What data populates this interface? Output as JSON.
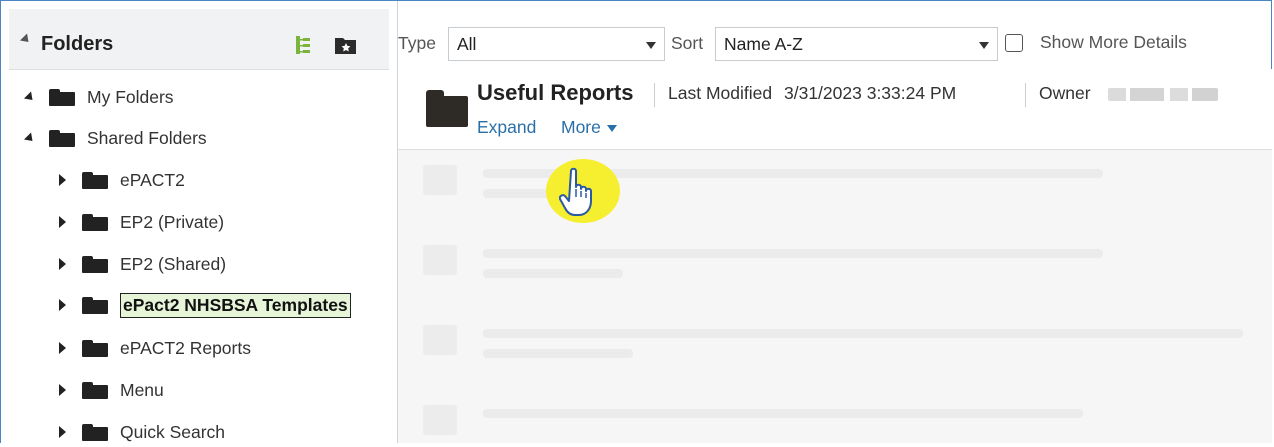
{
  "sidebar": {
    "title": "Folders",
    "header_icons": [
      "tree-view-icon",
      "favorite-folder-icon"
    ],
    "items": [
      {
        "label": "My Folders",
        "state": "expanded",
        "level": 0
      },
      {
        "label": "Shared Folders",
        "state": "expanded",
        "level": 0
      },
      {
        "label": "ePACT2",
        "state": "collapsed",
        "level": 1
      },
      {
        "label": "EP2 (Private)",
        "state": "collapsed",
        "level": 1
      },
      {
        "label": "EP2 (Shared)",
        "state": "collapsed",
        "level": 1
      },
      {
        "label": "ePact2 NHSBSA Templates",
        "state": "collapsed",
        "level": 1,
        "selected": true
      },
      {
        "label": "ePACT2 Reports",
        "state": "collapsed",
        "level": 1
      },
      {
        "label": "Menu",
        "state": "collapsed",
        "level": 1
      },
      {
        "label": "Quick Search",
        "state": "collapsed",
        "level": 1
      }
    ]
  },
  "toolbar": {
    "type_label": "Type",
    "type_value": "All",
    "sort_label": "Sort",
    "sort_value": "Name A-Z",
    "show_more_label": "Show More Details",
    "show_more_checked": false
  },
  "item": {
    "name": "Useful Reports",
    "last_modified_label": "Last Modified",
    "last_modified_value": "3/31/2023 3:33:24 PM",
    "owner_label": "Owner",
    "expand_label": "Expand",
    "more_label": "More"
  },
  "colors": {
    "selected_bg": "#e6f4d8",
    "link": "#2b6fa8",
    "cursor_highlight": "#f6ef2f",
    "header_bg": "#f1f2f3"
  }
}
